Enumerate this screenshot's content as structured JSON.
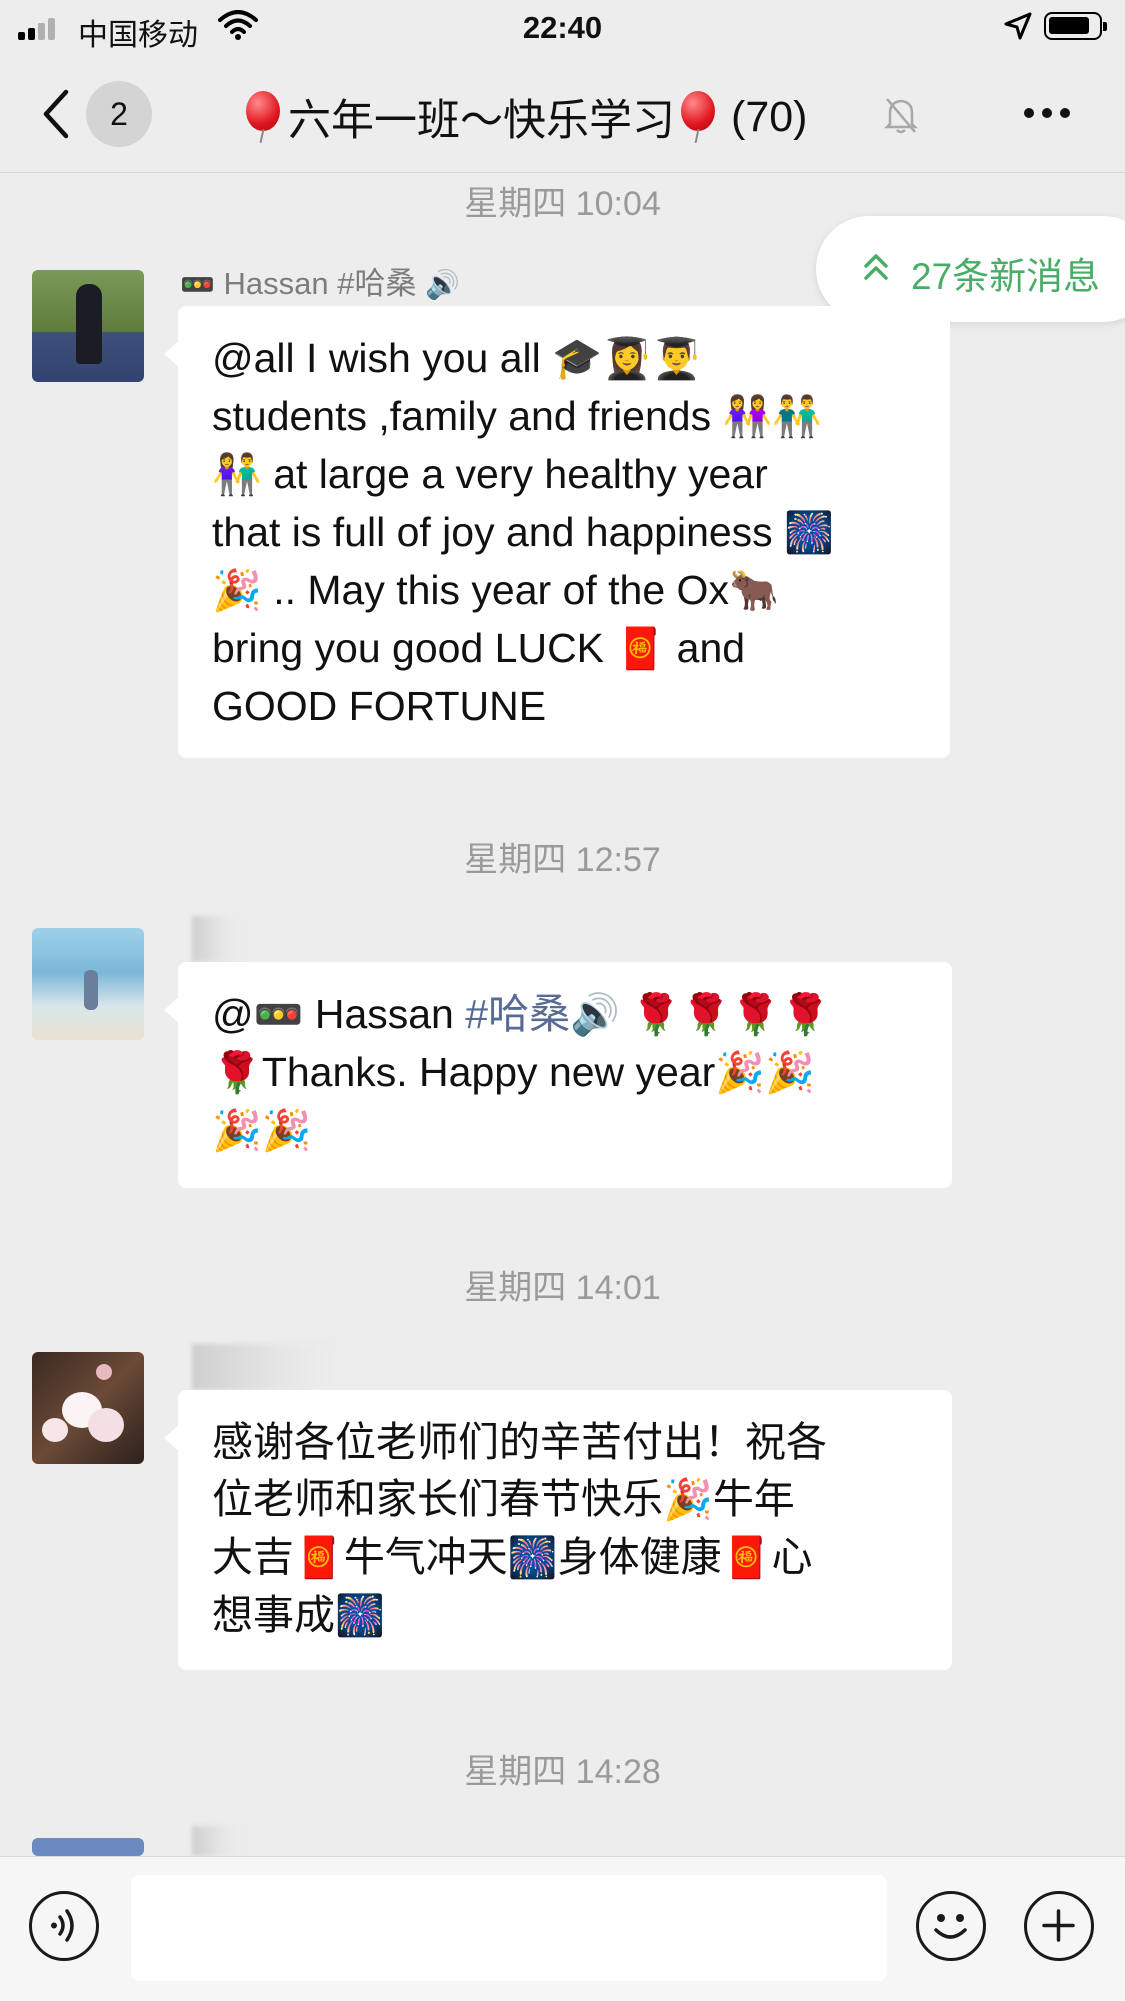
{
  "status_bar": {
    "carrier": "中国移动",
    "time": "22:40"
  },
  "nav": {
    "unread_count": "2",
    "title_text": "六年一班～快乐学习",
    "member_count": "(70)"
  },
  "new_messages": {
    "label": "27条新消息"
  },
  "messages": [
    {
      "timestamp": "星期四 10:04",
      "sender": "Hassan #哈桑",
      "lines": [
        "@all I wish you all",
        "students ,family and friends",
        "at large a very healthy year",
        "that is full of joy and happiness",
        ".. May this year  of the Ox",
        "bring you good LUCK",
        "and",
        "GOOD FORTUNE"
      ]
    },
    {
      "timestamp": "星期四 12:57",
      "mention_prefix": "@",
      "mention_name": "Hassan",
      "mention_tag": "#哈桑",
      "text": "Thanks. Happy new year"
    },
    {
      "timestamp": "星期四 14:01",
      "lines": [
        "感谢各位老师们的辛苦付出！祝各",
        "位老师和家长们春节快乐",
        "牛年",
        "大吉",
        "牛气冲天",
        "身体健康",
        "心",
        "想事成"
      ]
    },
    {
      "timestamp": "星期四 14:28"
    }
  ]
}
